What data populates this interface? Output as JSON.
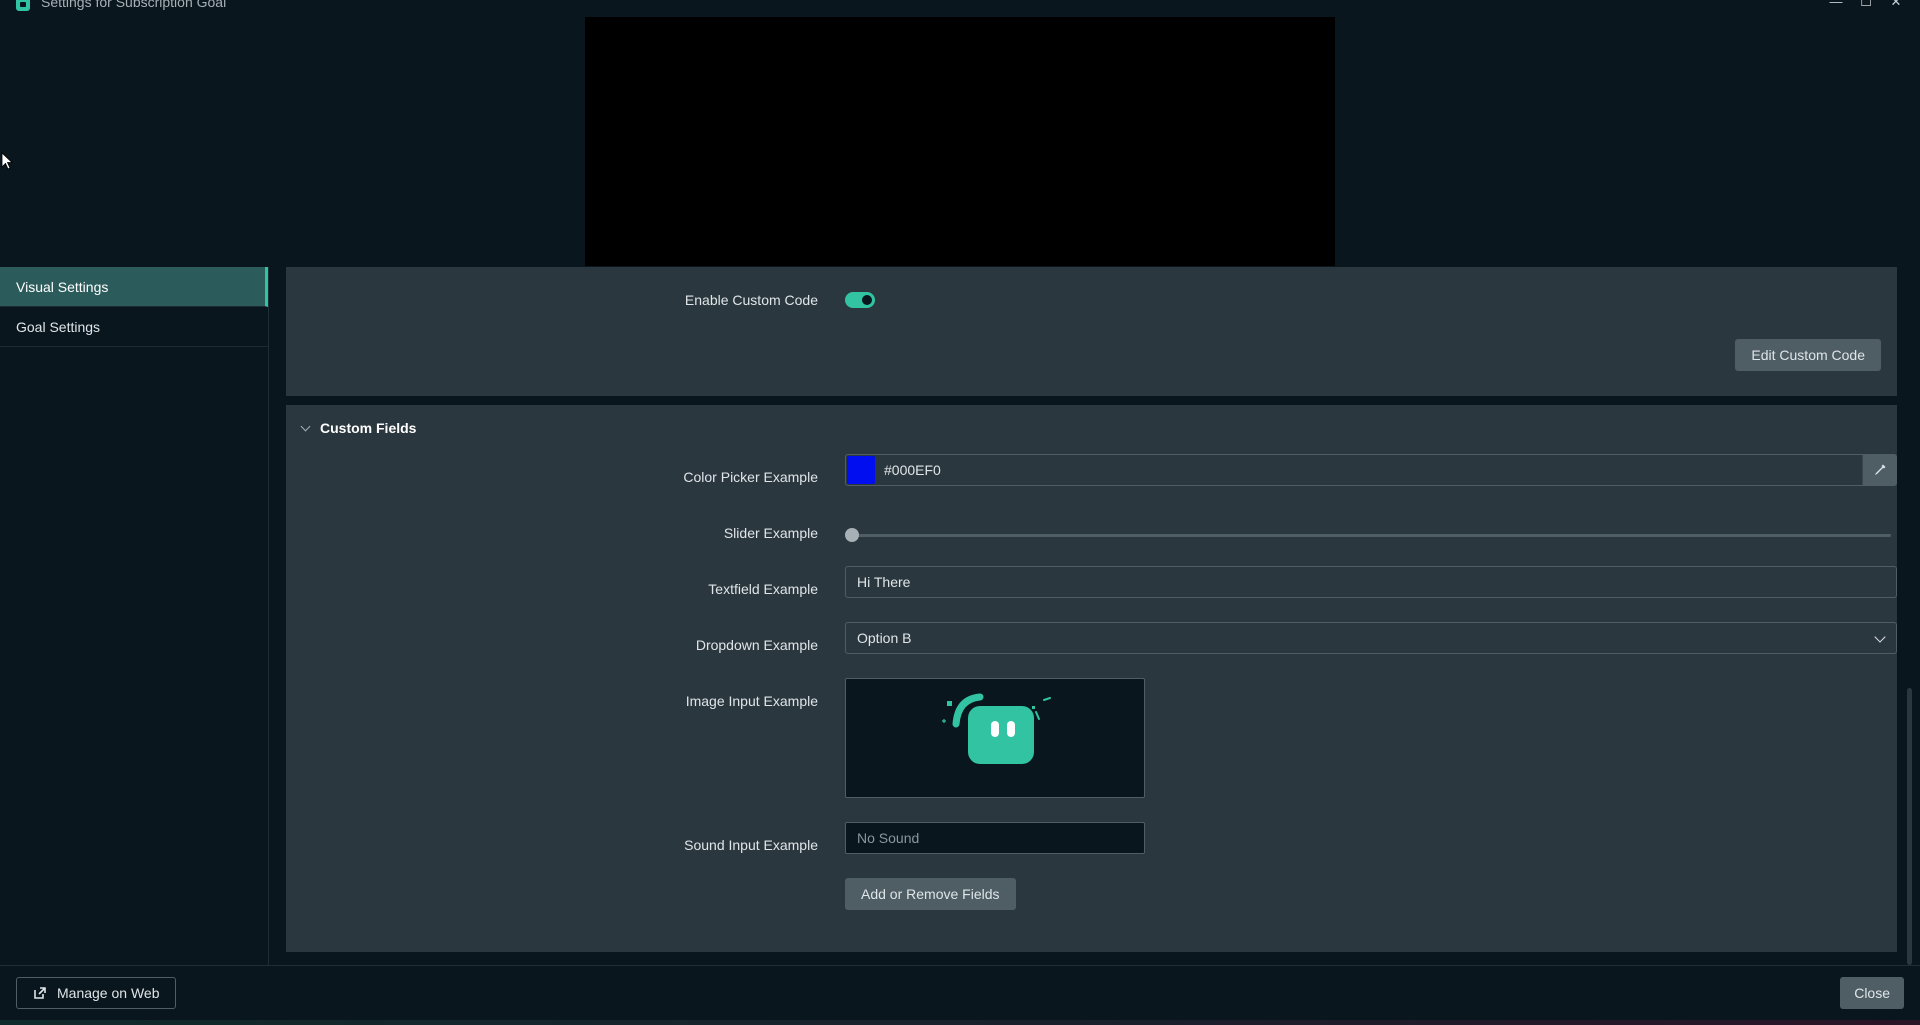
{
  "window": {
    "title": "Settings for Subscription Goal",
    "minimize_glyph": "—",
    "maximize_glyph": "☐",
    "close_glyph": "✕"
  },
  "sidebar": {
    "items": [
      {
        "label": "Visual Settings",
        "active": true
      },
      {
        "label": "Goal Settings",
        "active": false
      }
    ]
  },
  "custom_code": {
    "label": "Enable Custom Code",
    "enabled": true,
    "edit_button": "Edit Custom Code"
  },
  "custom_fields": {
    "section_title": "Custom Fields",
    "color_picker": {
      "label": "Color Picker Example",
      "value": "#000EF0",
      "swatch_color": "#000ef0"
    },
    "slider": {
      "label": "Slider Example",
      "value": 0
    },
    "textfield": {
      "label": "Textfield Example",
      "value": "Hi There"
    },
    "dropdown": {
      "label": "Dropdown Example",
      "value": "Option B"
    },
    "image_input": {
      "label": "Image Input Example"
    },
    "sound_input": {
      "label": "Sound Input Example",
      "value": "No Sound"
    },
    "add_remove_button": "Add or Remove Fields"
  },
  "footer": {
    "manage_button": "Manage on Web",
    "close_button": "Close"
  },
  "colors": {
    "accent": "#31c3a2",
    "background": "#09161d",
    "panel": "#2b373e",
    "button": "#4f5e65"
  }
}
